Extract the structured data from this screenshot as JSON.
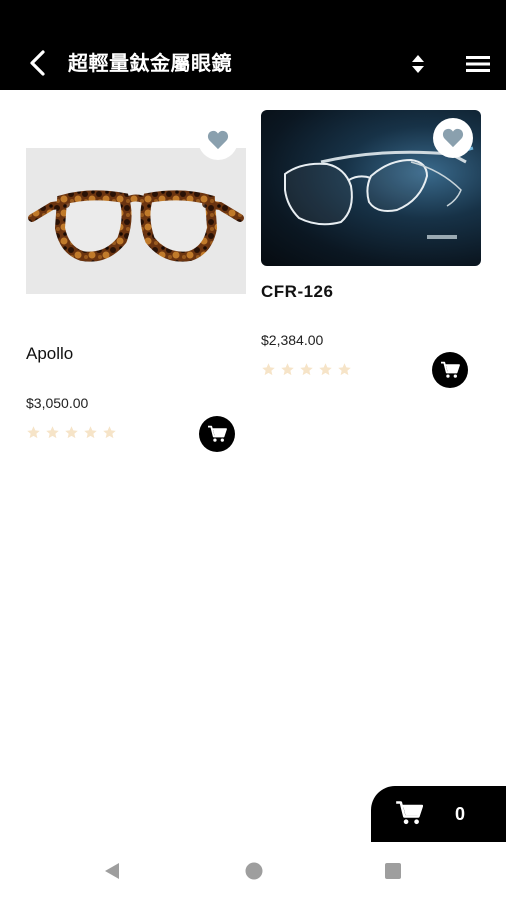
{
  "appbar": {
    "title": "超輕量鈦金屬眼鏡",
    "back_icon": "chevron-left-icon",
    "sort_icon": "sort-icon",
    "menu_icon": "hamburger-menu-icon"
  },
  "products": [
    {
      "name": "Apollo",
      "price": "$3,050.00",
      "rating": 0,
      "max_rating": 5,
      "favorite_icon": "heart-icon",
      "cart_icon": "cart-icon"
    },
    {
      "name": "CFR-126",
      "price": "$2,384.00",
      "rating": 0,
      "max_rating": 5,
      "favorite_icon": "heart-icon",
      "cart_icon": "cart-icon"
    }
  ],
  "cart": {
    "count": "0",
    "icon": "cart-icon"
  },
  "colors": {
    "bar": "#000000",
    "heart": "#8aa0ae",
    "star_empty": "#f6e4c8"
  }
}
